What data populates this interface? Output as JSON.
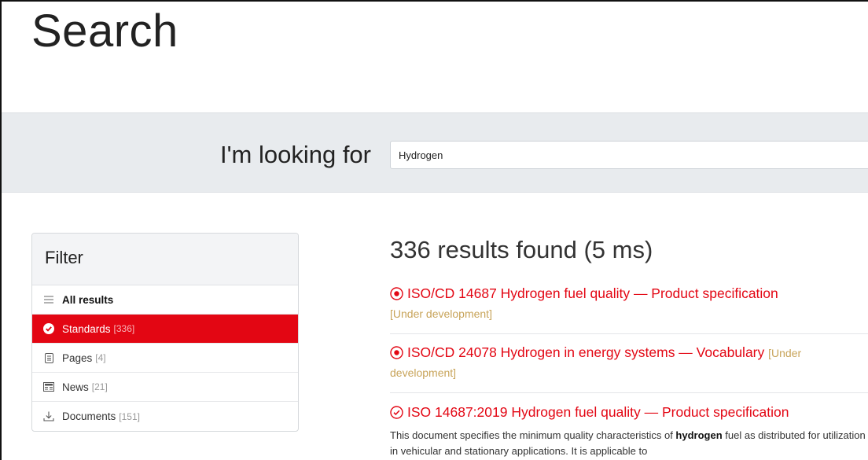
{
  "page": {
    "title": "Search"
  },
  "search": {
    "label": "I'm looking for",
    "value": "Hydrogen"
  },
  "filter": {
    "heading": "Filter",
    "items": [
      {
        "icon": "list-icon",
        "label": "All results",
        "count": ""
      },
      {
        "icon": "check-circle-icon",
        "label": "Standards",
        "count": "[336]"
      },
      {
        "icon": "page-icon",
        "label": "Pages",
        "count": "[4]"
      },
      {
        "icon": "news-icon",
        "label": "News",
        "count": "[21]"
      },
      {
        "icon": "download-icon",
        "label": "Documents",
        "count": "[151]"
      }
    ]
  },
  "results": {
    "summary": "336 results found (5 ms)",
    "items": [
      {
        "icon": "radio-dot-icon",
        "title": "ISO/CD 14687 Hydrogen fuel quality — Product specification",
        "status": "[Under development]"
      },
      {
        "icon": "radio-dot-icon",
        "title": "ISO/CD 24078 Hydrogen in energy systems — Vocabulary",
        "status": "[Under development]"
      },
      {
        "icon": "check-circle-outline-icon",
        "title": "ISO 14687:2019 Hydrogen fuel quality — Product specification",
        "desc_before": "This document specifies the minimum quality characteristics of ",
        "desc_bold": "hydrogen",
        "desc_after": " fuel as distributed for utilization in vehicular and stationary applications. It is applicable to"
      }
    ]
  },
  "colors": {
    "accent": "#e30613",
    "status": "#c8a45a",
    "band": "#e8ebee"
  }
}
